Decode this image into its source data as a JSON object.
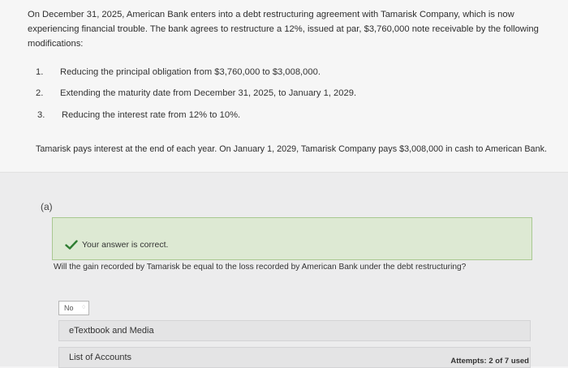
{
  "problem": {
    "intro": "On December 31, 2025, American Bank enters into a debt restructuring agreement with Tamarisk Company, which is now experiencing financial trouble. The bank agrees to restructure a 12%, issued at par, $3,760,000 note receivable by the following modifications:",
    "modifications": [
      {
        "number": "1.",
        "text": "Reducing the principal obligation from $3,760,000 to $3,008,000."
      },
      {
        "number": "2.",
        "text": "Extending the maturity date from December 31, 2025, to January 1, 2029."
      },
      {
        "number": "3.",
        "text": "Reducing the interest rate from 12% to 10%."
      }
    ],
    "payment_text": "Tamarisk pays interest at the end of each year. On January 1, 2029, Tamarisk Company pays $3,008,000 in cash to American Bank."
  },
  "part": {
    "label": "(a)",
    "feedback": "Your answer is correct.",
    "question": "Will the gain recorded by Tamarisk be equal to the loss recorded by American Bank under the debt restructuring?",
    "answer_select": {
      "value": "No"
    },
    "resources": [
      "eTextbook and Media",
      "List of Accounts"
    ],
    "attempts": "Attempts: 2 of 7 used"
  },
  "colors": {
    "success_bg": "#dde9d3",
    "success_border": "#a9c891",
    "check": "#2e7d32"
  }
}
